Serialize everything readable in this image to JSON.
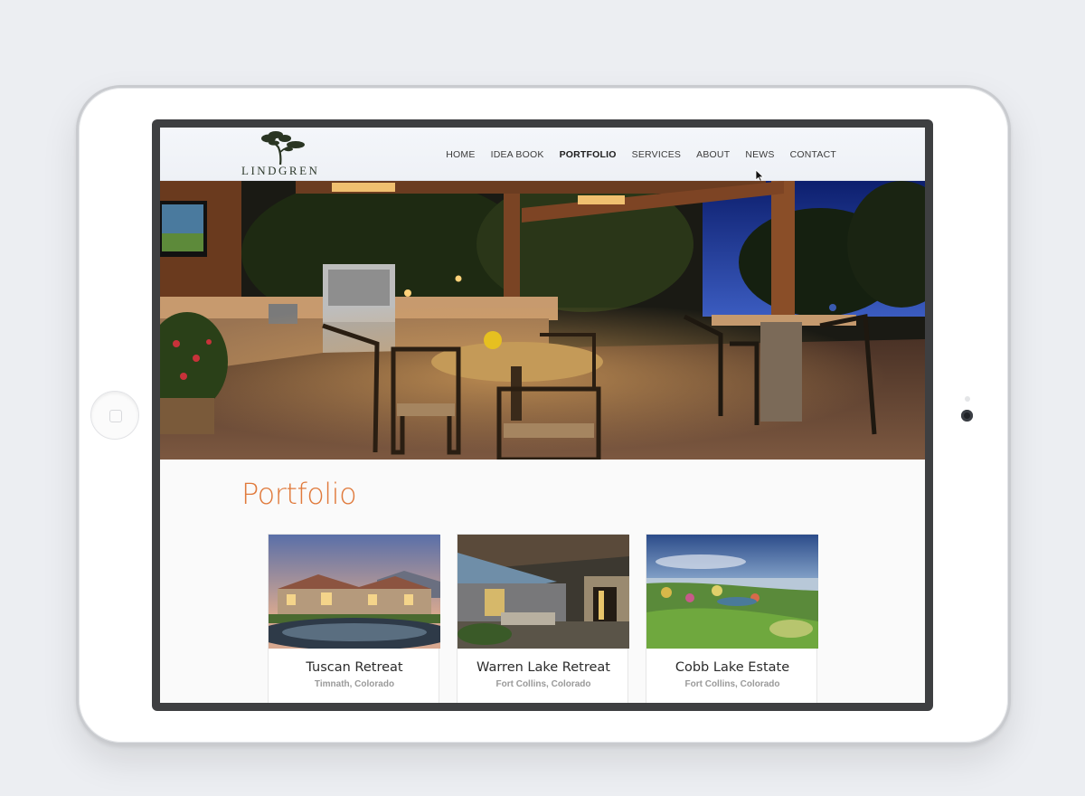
{
  "brand": {
    "name": "LINDGREN"
  },
  "nav": {
    "items": [
      {
        "label": "HOME",
        "active": false
      },
      {
        "label": "IDEA BOOK",
        "active": false
      },
      {
        "label": "PORTFOLIO",
        "active": true
      },
      {
        "label": "SERVICES",
        "active": false
      },
      {
        "label": "ABOUT",
        "active": false
      },
      {
        "label": "NEWS",
        "active": false
      },
      {
        "label": "CONTACT",
        "active": false
      }
    ]
  },
  "page": {
    "title": "Portfolio"
  },
  "projects": [
    {
      "name": "Tuscan Retreat",
      "location": "Timnath, Colorado"
    },
    {
      "name": "Warren Lake Retreat",
      "location": "Fort Collins, Colorado"
    },
    {
      "name": "Cobb Lake Estate",
      "location": "Fort Collins, Colorado"
    }
  ],
  "colors": {
    "accent": "#e07a3c",
    "bezel": "#3e3f41",
    "background": "#eceef2"
  },
  "icons": {
    "cursor": "arrow-pointer-icon",
    "home_button": "home-button-icon",
    "camera": "camera-icon"
  }
}
